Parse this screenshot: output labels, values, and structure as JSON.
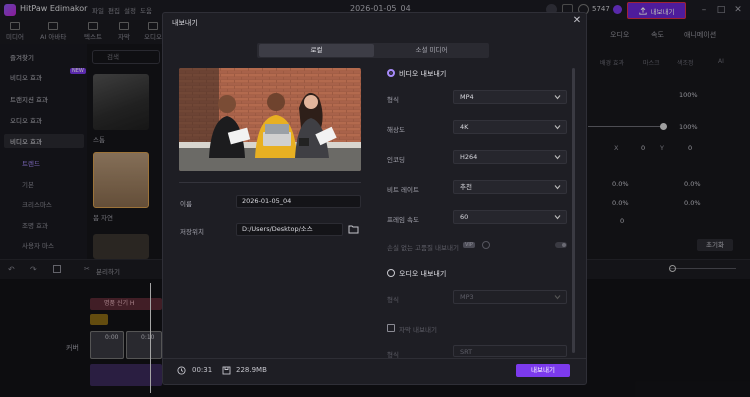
{
  "app": {
    "name": "HitPaw Edimakor",
    "menu": [
      "파일",
      "편집",
      "설정",
      "도움"
    ],
    "document_title": "2026-01-05_04",
    "credits": "5747",
    "export_label": "내보내기"
  },
  "toolbar": [
    "미디어",
    "AI 아바타",
    "텍스트",
    "자막",
    "오디오"
  ],
  "sidebar": {
    "items": [
      "즐겨찾기",
      "비디오 효과",
      "트랜지션 효과",
      "오디오 효과",
      "비디오 효과"
    ],
    "new_badge": "NEW",
    "sub_items": [
      "트렌드",
      "기본",
      "크리스마스",
      "조명 효과",
      "사용자 마스"
    ]
  },
  "media": {
    "search_placeholder": "검색",
    "items": [
      "스톰",
      "봄 자연"
    ]
  },
  "right_panel": {
    "tabs": [
      "오디오",
      "속도",
      "애니메이션"
    ],
    "subtabs": [
      "배경 효과",
      "마스크",
      "색조정",
      "AI"
    ],
    "scale_value": "100%",
    "opacity_value": "100%",
    "x_label": "X",
    "x_value": "0",
    "y_label": "Y",
    "y_value": "0",
    "val_a": "0.0%",
    "val_b": "0.0%",
    "val_c": "0.0%",
    "val_d": "0.0%",
    "angle": "0",
    "reset_label": "초기화"
  },
  "timeline": {
    "tools_label": "분리하기",
    "track_label": "커버",
    "clip_a": "명품 신기 H",
    "clip_b": "0:00",
    "clip_c": "0:10"
  },
  "modal": {
    "title": "내보내기",
    "tabs": [
      "로컬",
      "소셜 미디어"
    ],
    "name_label": "이름",
    "name_value": "2026-01-05_04",
    "location_label": "저장위치",
    "location_value": "D:/Users/Desktop/소스",
    "video_section": "비디오 내보내기",
    "format_label": "형식",
    "format_value": "MP4",
    "resolution_label": "해상도",
    "resolution_value": "4K",
    "encoder_label": "인코딩",
    "encoder_value": "H264",
    "bitrate_label": "비트 레이트",
    "bitrate_value": "추천",
    "framerate_label": "프레임 속도",
    "framerate_value": "60",
    "enhance_label": "손실 없는 고품질 내보내기",
    "vip_badge": "VIP",
    "audio_section": "오디오 내보내기",
    "audio_format_label": "형식",
    "audio_format_value": "MP3",
    "subtitle_label": "자막 내보내기",
    "subtitle_format_label": "형식",
    "subtitle_format_value": "SRT",
    "duration": "00:31",
    "size": "228.9MB",
    "export_button": "내보내기",
    "video_selected": true,
    "audio_selected": false
  },
  "colors": {
    "accent": "#7c3aed",
    "accent_light": "#a78bfa",
    "highlight_border": "#e0304c"
  }
}
